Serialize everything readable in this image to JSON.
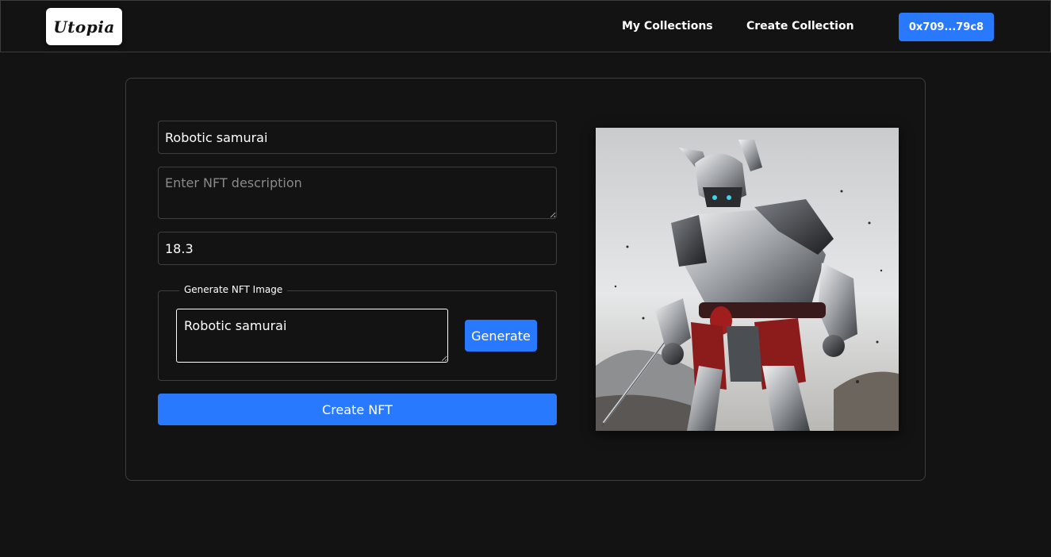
{
  "header": {
    "logo_text": "Utopia",
    "nav": [
      {
        "label": "My Collections"
      },
      {
        "label": "Create Collection"
      }
    ],
    "wallet_label": "0x709...79c8"
  },
  "form": {
    "name_value": "Robotic samurai",
    "description_placeholder": "Enter NFT description",
    "description_value": "",
    "price_value": "18.3",
    "generate_section": {
      "legend": "Generate NFT Image",
      "prompt_value": "Robotic samurai",
      "generate_label": "Generate"
    },
    "create_label": "Create NFT"
  },
  "preview": {
    "alt": "Robotic samurai",
    "icon": "generated-image"
  },
  "colors": {
    "background": "#131313",
    "accent": "#2979ff",
    "border": "#3f3f3f"
  }
}
